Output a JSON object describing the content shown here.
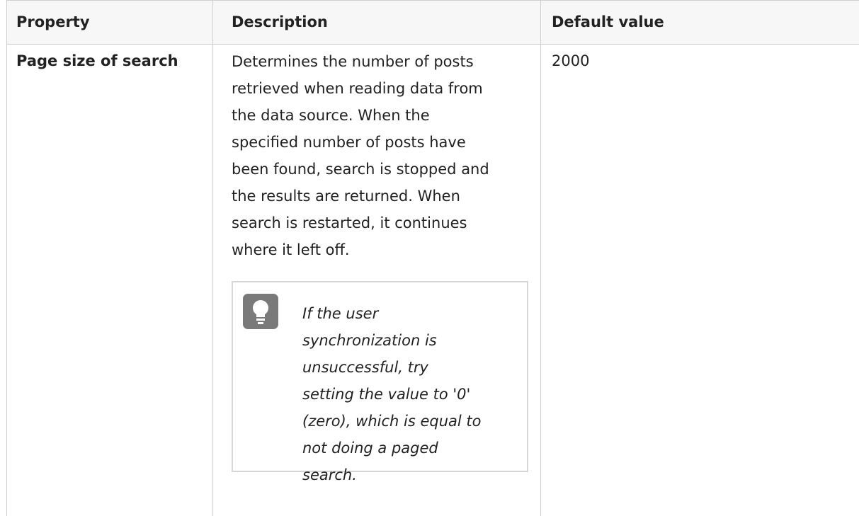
{
  "table": {
    "headers": {
      "property": "Property",
      "description": "Description",
      "default_value": "Default value"
    },
    "row": {
      "property": "Page size of search",
      "description_lines": [
        "Determines the number of posts",
        "retrieved when reading data from",
        "the data source. When the",
        "specified number of posts have",
        "been found, search is stopped and",
        "the results are returned. When",
        "search is restarted, it continues",
        "where it left off."
      ],
      "tip_lines": [
        "If the user",
        "synchronization is",
        "unsuccessful, try",
        "setting the value to '0'",
        "(zero), which is equal to",
        "not doing a paged",
        "search."
      ],
      "tip_icon": "lightbulb-icon",
      "default_value": "2000"
    }
  }
}
